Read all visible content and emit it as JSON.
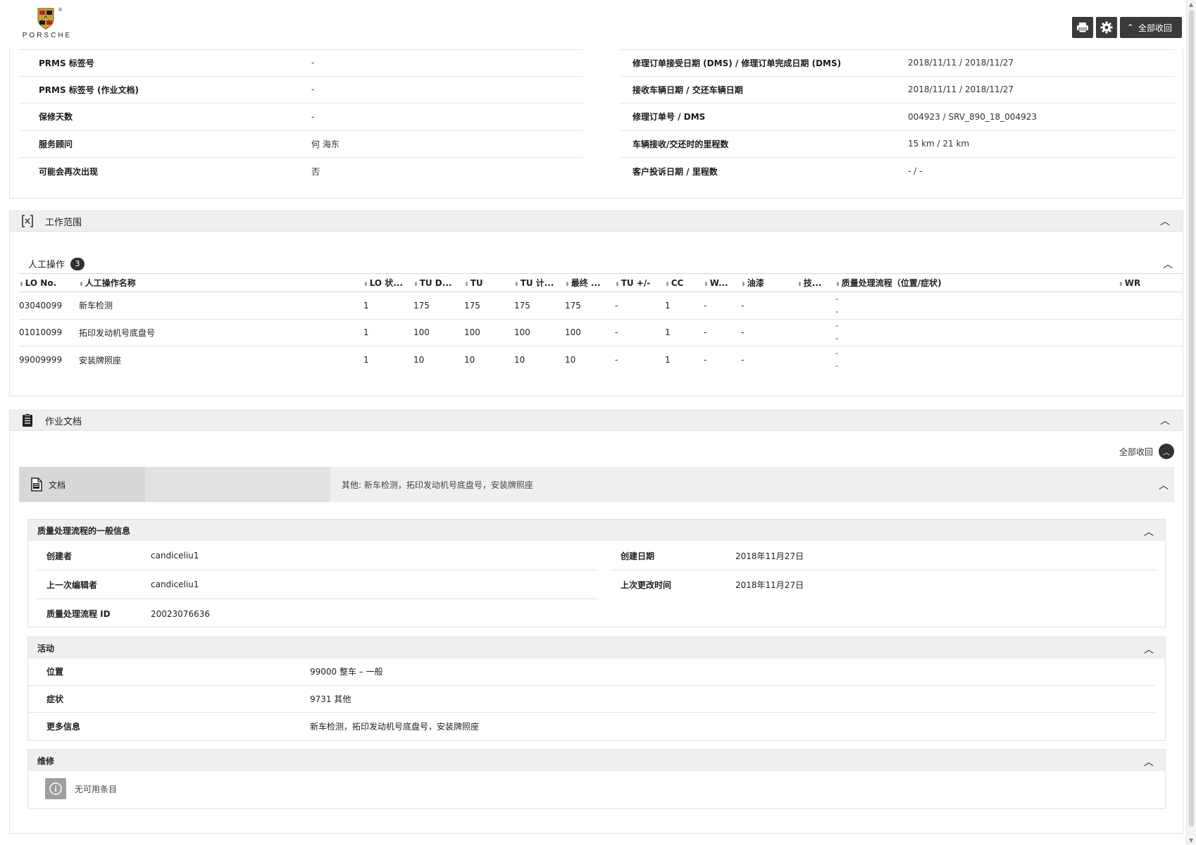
{
  "brand": {
    "name": "PORSCHE",
    "reg": "®"
  },
  "toolbar": {
    "collapse_all_label": "全部收回"
  },
  "info": {
    "left": [
      {
        "k": "PRMS 标签号",
        "v": "-"
      },
      {
        "k": "PRMS 标签号 (作业文档)",
        "v": "-"
      },
      {
        "k": "保修天数",
        "v": "-"
      },
      {
        "k": "服务顾问",
        "v": "何 海东"
      },
      {
        "k": "可能会再次出现",
        "v": "否"
      }
    ],
    "right": [
      {
        "k": "修理订单接受日期 (DMS) / 修理订单完成日期 (DMS)",
        "v": "2018/11/11 / 2018/11/27"
      },
      {
        "k": "接收车辆日期 / 交还车辆日期",
        "v": "2018/11/11 / 2018/11/27"
      },
      {
        "k": "修理订单号 / DMS",
        "v": "004923 / SRV_890_18_004923"
      },
      {
        "k": "车辆接收/交还时的里程数",
        "v": "15 km / 21 km"
      },
      {
        "k": "客户投诉日期 / 里程数",
        "v": "- / -"
      }
    ]
  },
  "work_scope": {
    "title": "工作范围",
    "labor_title": "人工操作",
    "labor_count": "3",
    "columns": [
      "LO No.",
      "人工操作名称",
      "LO 状...",
      "TU D...",
      "TU",
      "TU 计...",
      "最终 ...",
      "TU +/-",
      "CC",
      "W...",
      "油漆",
      "技...",
      "质量处理流程（位置/症状)",
      "WR"
    ],
    "rows": [
      {
        "lo_no": "03040099",
        "name": "新车检测",
        "lo_status": "1",
        "tu_d": "175",
        "tu": "175",
        "tu_calc": "175",
        "final": "175",
        "tu_pm": "-",
        "cc": "1",
        "w": "-",
        "paint": "-",
        "tech": "",
        "qp1": "-",
        "qp2": "-",
        "wr": ""
      },
      {
        "lo_no": "01010099",
        "name": "拓印发动机号底盘号",
        "lo_status": "1",
        "tu_d": "100",
        "tu": "100",
        "tu_calc": "100",
        "final": "100",
        "tu_pm": "-",
        "cc": "1",
        "w": "-",
        "paint": "-",
        "tech": "",
        "qp1": "-",
        "qp2": "-",
        "wr": ""
      },
      {
        "lo_no": "99009999",
        "name": "安装牌照座",
        "lo_status": "1",
        "tu_d": "10",
        "tu": "10",
        "tu_calc": "10",
        "final": "10",
        "tu_pm": "-",
        "cc": "1",
        "w": "-",
        "paint": "-",
        "tech": "",
        "qp1": "-",
        "qp2": "-",
        "wr": ""
      }
    ]
  },
  "job_docs": {
    "title": "作业文档",
    "collapse_all_label": "全部收回",
    "tab_label": "文档",
    "summary": "其他: 新车检测，拓印发动机号底盘号，安装牌照座",
    "general": {
      "title": "质量处理流程的一般信息",
      "creator_label": "创建者",
      "creator": "candiceliu1",
      "last_editor_label": "上一次编辑者",
      "last_editor": "candiceliu1",
      "qp_id_label": "质量处理流程 ID",
      "qp_id": "20023076636",
      "created_date_label": "创建日期",
      "created_date": "2018年11月27日",
      "modified_label": "上次更改时间",
      "modified": "2018年11月27日"
    },
    "activity": {
      "title": "活动",
      "rows": [
        {
          "k": "位置",
          "v": "99000 整车 – 一般"
        },
        {
          "k": "症状",
          "v": "9731 其他"
        },
        {
          "k": "更多信息",
          "v": "新车检测，拓印发动机号底盘号，安装牌照座"
        }
      ]
    },
    "repair": {
      "title": "维修",
      "empty": "无可用条目"
    }
  }
}
